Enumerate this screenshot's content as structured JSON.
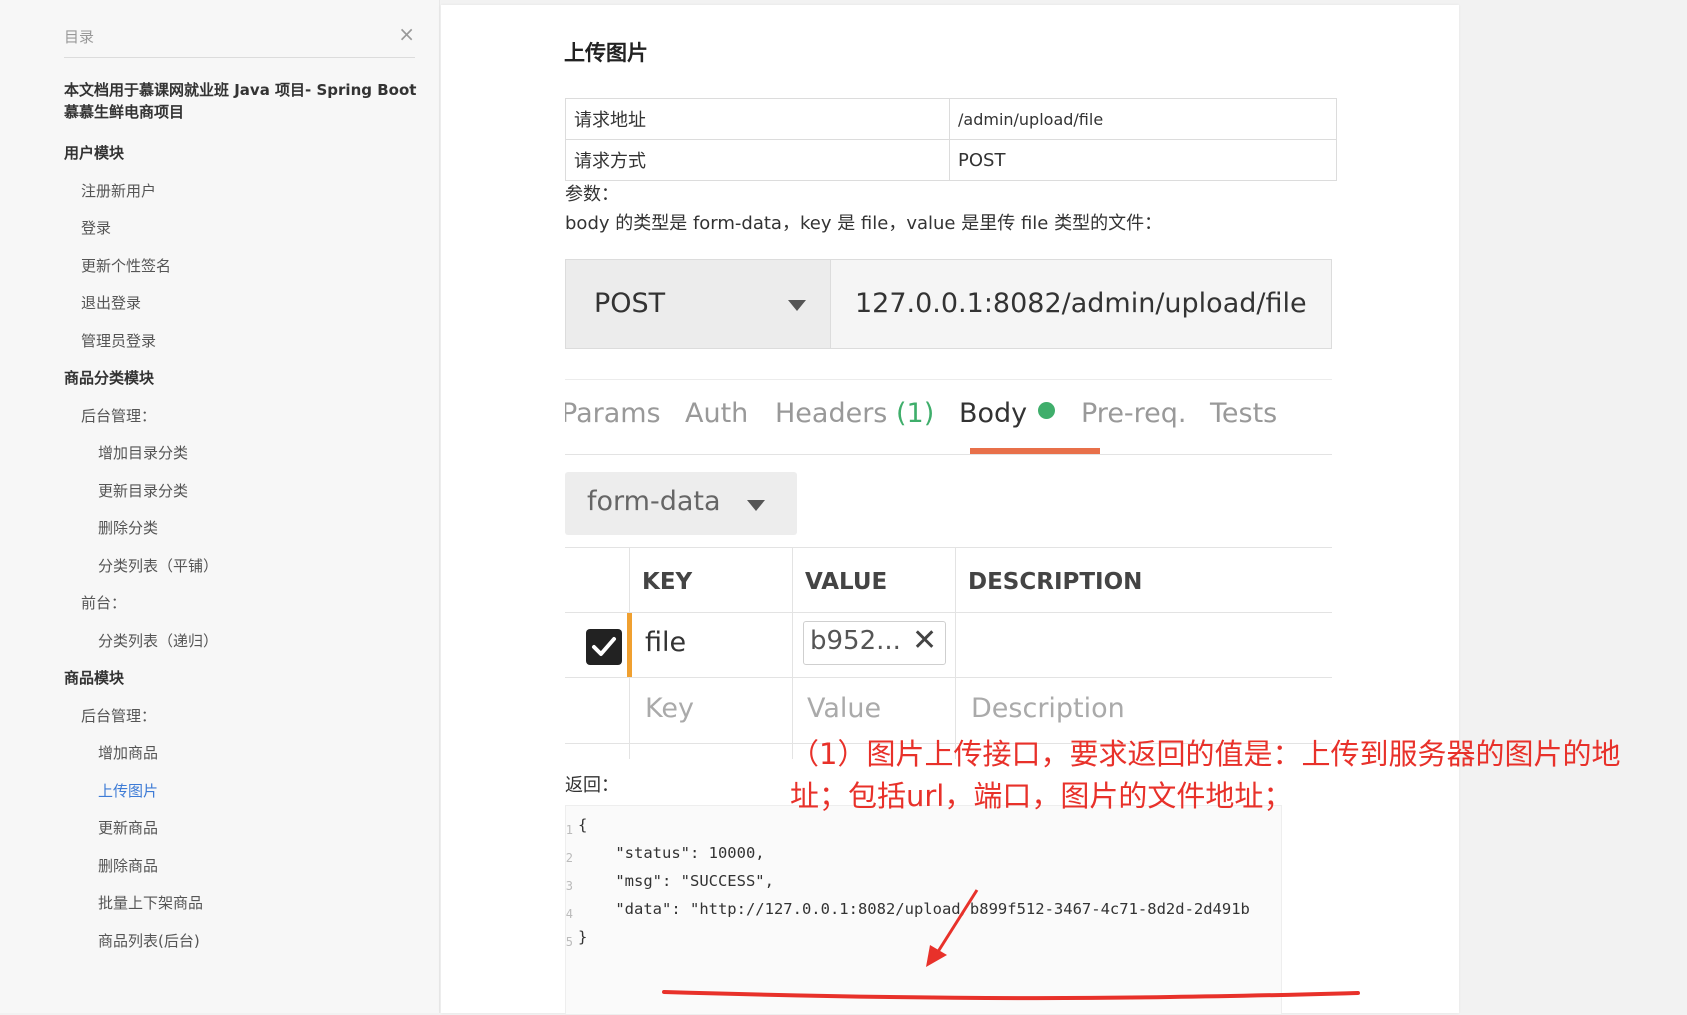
{
  "toc": {
    "title": "目录",
    "close_icon": "×",
    "doc_title": "本文档用于慕课网就业班 Java 项目- Spring Boot 慕慕生鲜电商项目",
    "items": [
      {
        "label": "用户模块",
        "level": 1
      },
      {
        "label": "注册新用户",
        "level": 2
      },
      {
        "label": "登录",
        "level": 2
      },
      {
        "label": "更新个性签名",
        "level": 2
      },
      {
        "label": "退出登录",
        "level": 2
      },
      {
        "label": "管理员登录",
        "level": 2
      },
      {
        "label": "商品分类模块",
        "level": 1
      },
      {
        "label": "后台管理：",
        "level": 2
      },
      {
        "label": "增加目录分类",
        "level": 3
      },
      {
        "label": "更新目录分类",
        "level": 3
      },
      {
        "label": "删除分类",
        "level": 3
      },
      {
        "label": "分类列表（平铺）",
        "level": 3
      },
      {
        "label": "前台：",
        "level": 2
      },
      {
        "label": "分类列表（递归）",
        "level": 3
      },
      {
        "label": "商品模块",
        "level": 1
      },
      {
        "label": "后台管理：",
        "level": 2
      },
      {
        "label": "增加商品",
        "level": 3
      },
      {
        "label": "上传图片",
        "level": 3,
        "active": true
      },
      {
        "label": "更新商品",
        "level": 3
      },
      {
        "label": "删除商品",
        "level": 3
      },
      {
        "label": "批量上下架商品",
        "level": 3
      },
      {
        "label": "商品列表(后台)",
        "level": 3
      }
    ]
  },
  "article": {
    "heading": "上传图片",
    "info": {
      "address_label": "请求地址",
      "address_value": "/admin/upload/file",
      "method_label": "请求方式",
      "method_value": "POST"
    },
    "params_label": "参数：",
    "body_desc": "body 的类型是 form-data，key 是 file，value 是里传 file 类型的文件：",
    "return_label": "返回："
  },
  "postman": {
    "method": "POST",
    "url": "127.0.0.1:8082/admin/upload/file",
    "tabs": [
      {
        "label": "Params"
      },
      {
        "label": "Auth"
      },
      {
        "label": "Headers",
        "count": "(1)"
      },
      {
        "label": "Body",
        "active": true
      },
      {
        "label": "Pre-req."
      },
      {
        "label": "Tests"
      }
    ],
    "body_type": "form-data",
    "columns": {
      "key": "KEY",
      "value": "VALUE",
      "description": "DESCRIPTION"
    },
    "row": {
      "key": "file",
      "value": "b952...",
      "checked": true
    },
    "placeholders": {
      "key": "Key",
      "value": "Value",
      "description": "Description"
    }
  },
  "code": {
    "line_numbers": [
      "1",
      "2",
      "3",
      "4",
      "5"
    ],
    "lines": [
      "{",
      "    \"status\": 10000,",
      "    \"msg\": \"SUCCESS\",",
      "    \"data\": \"http://127.0.0.1:8082/upload/b899f512-3467-4c71-8d2d-2d491b",
      "}"
    ]
  },
  "annotation": {
    "text": "（1）图片上传接口，要求返回的值是：上传到服务器的图片的地址；包括url，端口，图片的文件地址；",
    "color": "#e8312a"
  },
  "colors": {
    "accent_orange": "#e8704a",
    "active_link": "#3d7bd6",
    "green": "#3fae6b"
  }
}
